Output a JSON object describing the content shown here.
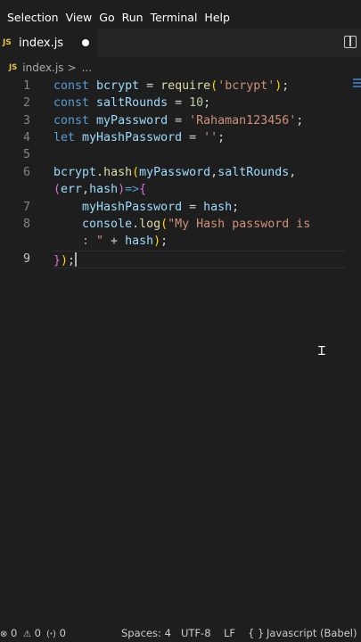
{
  "menu": [
    "Selection",
    "View",
    "Go",
    "Run",
    "Terminal",
    "Help"
  ],
  "tab": {
    "badge": "JS",
    "filename": "index.js"
  },
  "breadcrumb": {
    "badge": "JS",
    "file": "index.js",
    "separator": ">",
    "more": "..."
  },
  "editor": {
    "lines": [
      {
        "n": "1",
        "tokens": [
          [
            "kw",
            "const "
          ],
          [
            "var",
            "bcrypt"
          ],
          [
            "op",
            " = "
          ],
          [
            "fn",
            "require"
          ],
          [
            "brk",
            "("
          ],
          [
            "str",
            "'bcrypt'"
          ],
          [
            "brk",
            ")"
          ],
          [
            "op",
            ";"
          ]
        ]
      },
      {
        "n": "2",
        "tokens": [
          [
            "kw",
            "const "
          ],
          [
            "var",
            "saltRounds"
          ],
          [
            "op",
            " = "
          ],
          [
            "num",
            "10"
          ],
          [
            "op",
            ";"
          ]
        ]
      },
      {
        "n": "3",
        "tokens": [
          [
            "kw",
            "const "
          ],
          [
            "var",
            "myPassword"
          ],
          [
            "op",
            " = "
          ],
          [
            "str",
            "'Rahaman123456'"
          ],
          [
            "op",
            ";"
          ]
        ]
      },
      {
        "n": "4",
        "tokens": [
          [
            "kw",
            "let "
          ],
          [
            "var",
            "myHashPassword"
          ],
          [
            "op",
            " = "
          ],
          [
            "str",
            "''"
          ],
          [
            "op",
            ";"
          ]
        ]
      },
      {
        "n": "5",
        "tokens": []
      },
      {
        "n": "6",
        "tokens": [
          [
            "var",
            "bcrypt"
          ],
          [
            "op",
            "."
          ],
          [
            "fn",
            "hash"
          ],
          [
            "brk",
            "("
          ],
          [
            "var",
            "myPassword"
          ],
          [
            "op",
            ","
          ],
          [
            "var",
            "saltRounds"
          ],
          [
            "op",
            ","
          ]
        ]
      },
      {
        "n": "",
        "tokens": [
          [
            "brk2",
            "("
          ],
          [
            "var",
            "err"
          ],
          [
            "op",
            ","
          ],
          [
            "var",
            "hash"
          ],
          [
            "brk2",
            ")"
          ],
          [
            "kw",
            "=>"
          ],
          [
            "brk2",
            "{"
          ]
        ]
      },
      {
        "n": "7",
        "tokens": [
          [
            "op",
            "    "
          ],
          [
            "var",
            "myHashPassword"
          ],
          [
            "op",
            " = "
          ],
          [
            "var",
            "hash"
          ],
          [
            "op",
            ";"
          ]
        ]
      },
      {
        "n": "8",
        "tokens": [
          [
            "op",
            "    "
          ],
          [
            "var",
            "console"
          ],
          [
            "op",
            "."
          ],
          [
            "fn",
            "log"
          ],
          [
            "brk",
            "("
          ],
          [
            "str",
            "\"My Hash password is"
          ]
        ]
      },
      {
        "n": "",
        "tokens": [
          [
            "str",
            "    : \""
          ],
          [
            "op",
            " + "
          ],
          [
            "var",
            "hash"
          ],
          [
            "brk",
            ")"
          ],
          [
            "op",
            ";"
          ]
        ]
      },
      {
        "n": "9",
        "tokens": [
          [
            "brk2",
            "}"
          ],
          [
            "brk",
            ")"
          ],
          [
            "op",
            ";"
          ]
        ]
      }
    ]
  },
  "status": {
    "errors": "0",
    "warnings": "0",
    "ports": "0",
    "spaces": "Spaces: 4",
    "encoding": "UTF-8",
    "eol": "LF",
    "braces": "{ }",
    "language": "Javascript (Babel)"
  }
}
